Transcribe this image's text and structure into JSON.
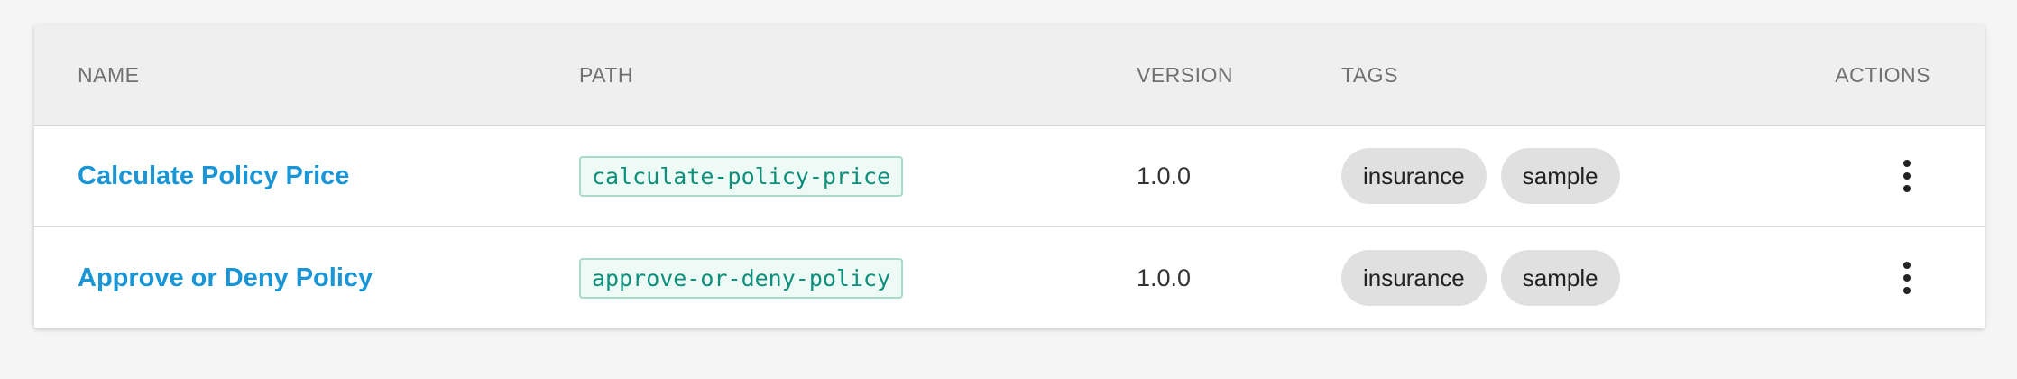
{
  "table": {
    "headers": {
      "name": "NAME",
      "path": "PATH",
      "version": "VERSION",
      "tags": "TAGS",
      "actions": "ACTIONS"
    },
    "rows": [
      {
        "name": "Calculate Policy Price",
        "path": "calculate-policy-price",
        "version": "1.0.0",
        "tags": [
          "insurance",
          "sample"
        ],
        "actions_icon": "more-vertical-icon"
      },
      {
        "name": "Approve or Deny Policy",
        "path": "approve-or-deny-policy",
        "version": "1.0.0",
        "tags": [
          "insurance",
          "sample"
        ],
        "actions_icon": "more-vertical-icon"
      }
    ]
  },
  "colors": {
    "link": "#1a95d6",
    "code_text": "#0d8f7c",
    "code_bg": "#eefaf5",
    "code_border": "#a8dcc6",
    "chip_bg": "#e0e0e0",
    "header_bg": "#efefef"
  }
}
